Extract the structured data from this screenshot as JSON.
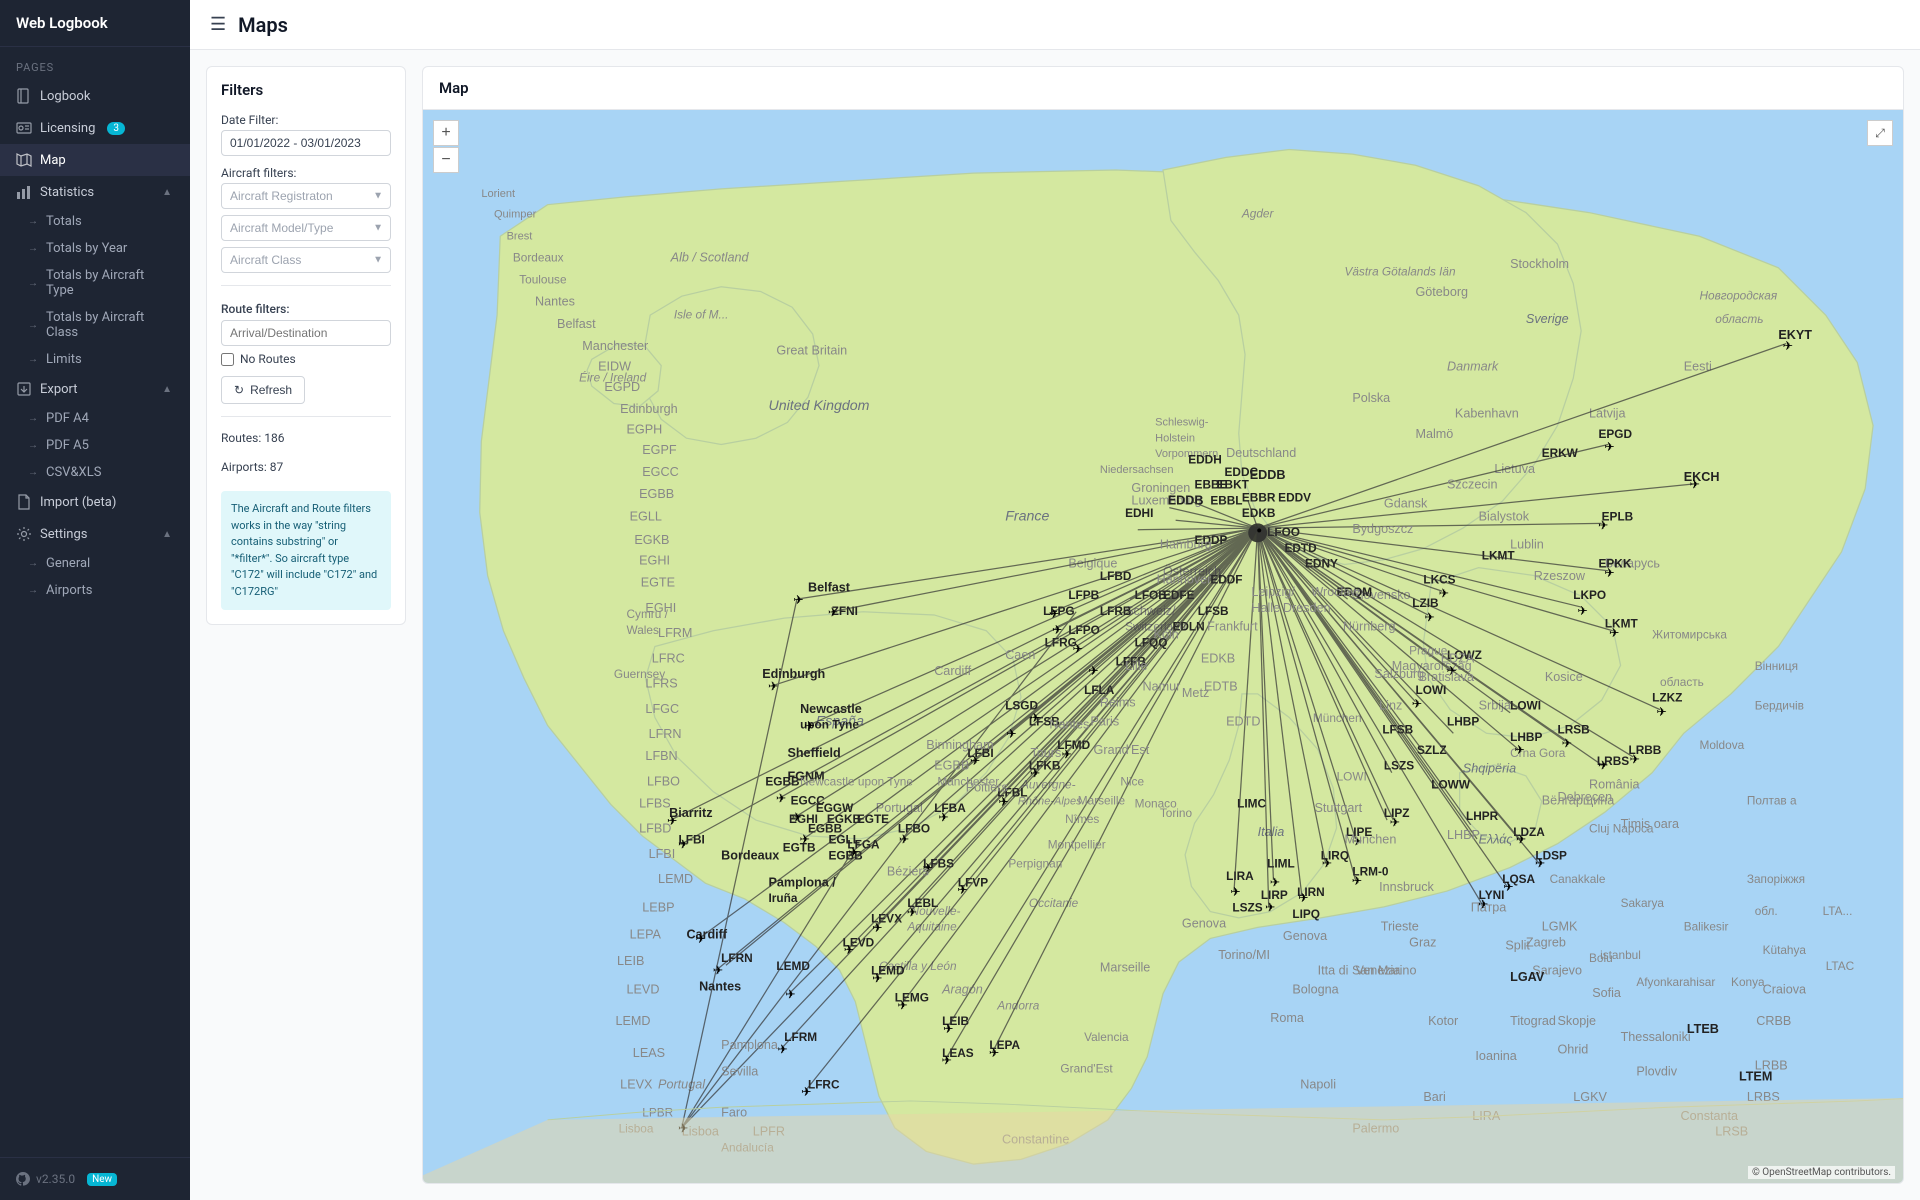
{
  "app": {
    "title": "Web Logbook",
    "page_title": "Maps"
  },
  "sidebar": {
    "pages_label": "Pages",
    "items": [
      {
        "id": "logbook",
        "label": "Logbook",
        "icon": "book"
      },
      {
        "id": "licensing",
        "label": "Licensing",
        "badge": "3",
        "icon": "id-card"
      },
      {
        "id": "map",
        "label": "Map",
        "icon": "map"
      },
      {
        "id": "statistics",
        "label": "Statistics",
        "icon": "bar-chart",
        "expandable": true,
        "expanded": true
      },
      {
        "id": "export",
        "label": "Export",
        "icon": "export",
        "expandable": true,
        "expanded": true
      },
      {
        "id": "import",
        "label": "Import (beta)",
        "icon": "file"
      },
      {
        "id": "settings",
        "label": "Settings",
        "icon": "gear",
        "expandable": true,
        "expanded": true
      }
    ],
    "statistics_sub": [
      {
        "id": "totals",
        "label": "Totals"
      },
      {
        "id": "totals-by-year",
        "label": "Totals by Year"
      },
      {
        "id": "totals-by-aircraft-type",
        "label": "Totals by Aircraft Type"
      },
      {
        "id": "totals-by-aircraft-class",
        "label": "Totals by Aircraft Class"
      },
      {
        "id": "limits",
        "label": "Limits"
      }
    ],
    "export_sub": [
      {
        "id": "pdf-a4",
        "label": "PDF A4"
      },
      {
        "id": "pdf-a5",
        "label": "PDF A5"
      },
      {
        "id": "csv-xls",
        "label": "CSV&XLS"
      }
    ],
    "settings_sub": [
      {
        "id": "general",
        "label": "General"
      },
      {
        "id": "airports",
        "label": "Airports"
      }
    ],
    "version": "v2.35.0",
    "version_badge": "New"
  },
  "filters": {
    "title": "Filters",
    "date_filter_label": "Date Filter:",
    "date_value": "01/01/2022 - 03/01/2023",
    "aircraft_filters_label": "Aircraft filters:",
    "aircraft_registration_placeholder": "Aircraft Registraton",
    "aircraft_model_placeholder": "Aircraft Model/Type",
    "aircraft_class_placeholder": "Aircraft Class",
    "route_filters_label": "Route filters:",
    "arrival_destination_placeholder": "Arrival/Destination",
    "no_routes_label": "No Routes",
    "refresh_label": "Refresh",
    "routes_count": "Routes: 186",
    "airports_count": "Airports: 87",
    "info_text": "The Aircraft and Route filters works in the way \"string contains substring\" or \"*filter*\". So aircraft type \"C172\" will include \"C172\" and \"C172RG\""
  },
  "map": {
    "title": "Map",
    "zoom_in": "+",
    "zoom_out": "−",
    "attribution": "© OpenStreetMap contributors."
  }
}
